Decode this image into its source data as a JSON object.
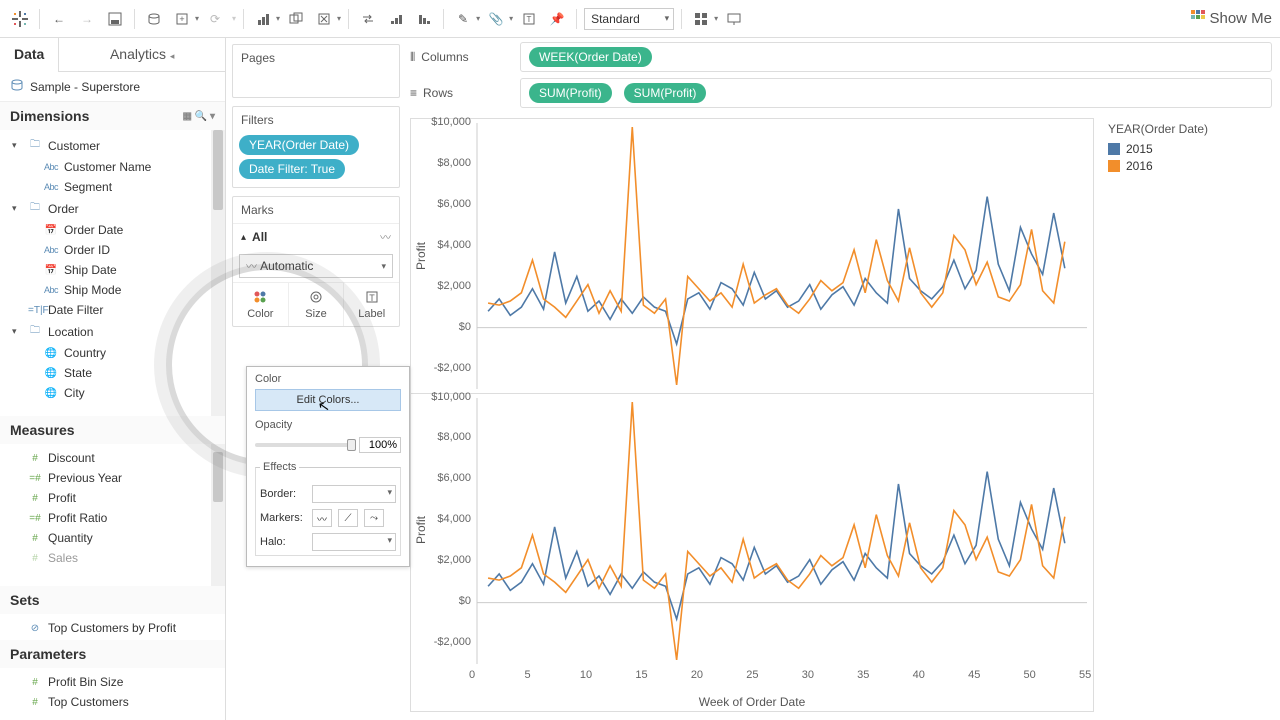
{
  "toolbar": {
    "fit_mode": "Standard",
    "show_me": "Show Me"
  },
  "data_pane": {
    "tab_data": "Data",
    "tab_analytics": "Analytics",
    "source": "Sample - Superstore",
    "sections": {
      "dimensions": "Dimensions",
      "measures": "Measures",
      "sets": "Sets",
      "parameters": "Parameters"
    },
    "dimensions": {
      "customer": {
        "label": "Customer",
        "children": [
          "Customer Name",
          "Segment"
        ]
      },
      "order": {
        "label": "Order",
        "children": [
          "Order Date",
          "Order ID",
          "Ship Date",
          "Ship Mode"
        ]
      },
      "date_filter": "Date Filter",
      "location": {
        "label": "Location",
        "children": [
          "Country",
          "State",
          "City"
        ]
      }
    },
    "measures": [
      "Discount",
      "Previous Year",
      "Profit",
      "Profit Ratio",
      "Quantity",
      "Sales"
    ],
    "sets": [
      "Top Customers by Profit"
    ],
    "parameters": [
      "Profit Bin Size",
      "Top Customers"
    ]
  },
  "cards": {
    "pages": "Pages",
    "filters": "Filters",
    "filter_pills": [
      "YEAR(Order Date)",
      "Date Filter: True"
    ],
    "marks": "Marks",
    "marks_all": "All",
    "marks_type": "Automatic",
    "marks_cells": {
      "color": "Color",
      "size": "Size",
      "label": "Label"
    }
  },
  "color_popup": {
    "title": "Color",
    "edit": "Edit Colors...",
    "opacity_label": "Opacity",
    "opacity_value": "100%",
    "effects": "Effects",
    "border": "Border:",
    "markers": "Markers:",
    "halo": "Halo:"
  },
  "shelves": {
    "columns": "Columns",
    "rows": "Rows",
    "col_pill": "WEEK(Order Date)",
    "row_pill1": "SUM(Profit)",
    "row_pill2": "SUM(Profit)"
  },
  "legend": {
    "title": "YEAR(Order Date)",
    "items": [
      {
        "label": "2015",
        "color": "#4e79a7"
      },
      {
        "label": "2016",
        "color": "#f28e2b"
      }
    ]
  },
  "chart_data": [
    {
      "type": "line",
      "title": "",
      "xlabel": "Week of Order Date",
      "ylabel": "Profit",
      "xlim": [
        0,
        55
      ],
      "ylim": [
        -3000,
        10000
      ],
      "y_ticks": [
        -2000,
        0,
        2000,
        4000,
        6000,
        8000,
        10000
      ],
      "y_tick_labels": [
        "-$2,000",
        "$0",
        "$2,000",
        "$4,000",
        "$6,000",
        "$8,000",
        "$10,000"
      ],
      "x_ticks": [
        0,
        5,
        10,
        15,
        20,
        25,
        30,
        35,
        40,
        45,
        50,
        55
      ],
      "series": [
        {
          "name": "2015",
          "color": "#4e79a7",
          "x": [
            1,
            2,
            3,
            4,
            5,
            6,
            7,
            8,
            9,
            10,
            11,
            12,
            13,
            14,
            15,
            16,
            17,
            18,
            19,
            20,
            21,
            22,
            23,
            24,
            25,
            26,
            27,
            28,
            29,
            30,
            31,
            32,
            33,
            34,
            35,
            36,
            37,
            38,
            39,
            40,
            41,
            42,
            43,
            44,
            45,
            46,
            47,
            48,
            49,
            50,
            51,
            52,
            53
          ],
          "values": [
            800,
            1400,
            600,
            1000,
            1900,
            900,
            3700,
            1200,
            2500,
            800,
            1300,
            400,
            1400,
            700,
            1500,
            1000,
            800,
            -800,
            1400,
            1700,
            900,
            2200,
            1900,
            1100,
            2700,
            1400,
            1800,
            1000,
            1300,
            2100,
            900,
            1600,
            2000,
            1100,
            2400,
            1700,
            1200,
            5800,
            2400,
            1800,
            1400,
            2000,
            3300,
            1900,
            2800,
            6400,
            3100,
            1800,
            4900,
            3600,
            2600,
            5600,
            2900
          ]
        },
        {
          "name": "2016",
          "color": "#f28e2b",
          "x": [
            1,
            2,
            3,
            4,
            5,
            6,
            7,
            8,
            9,
            10,
            11,
            12,
            13,
            14,
            15,
            16,
            17,
            18,
            19,
            20,
            21,
            22,
            23,
            24,
            25,
            26,
            27,
            28,
            29,
            30,
            31,
            32,
            33,
            34,
            35,
            36,
            37,
            38,
            39,
            40,
            41,
            42,
            43,
            44,
            45,
            46,
            47,
            48,
            49,
            50,
            51,
            52,
            53
          ],
          "values": [
            1200,
            1100,
            1300,
            1700,
            3300,
            1400,
            1000,
            500,
            1300,
            2100,
            700,
            1800,
            800,
            9800,
            1100,
            700,
            1400,
            -2800,
            2500,
            1900,
            1300,
            1700,
            1000,
            3100,
            1200,
            1600,
            1900,
            1100,
            700,
            1400,
            2300,
            1800,
            2200,
            3800,
            1700,
            4300,
            2300,
            1300,
            3900,
            1700,
            1000,
            1700,
            4500,
            3800,
            2100,
            3200,
            1500,
            1300,
            2100,
            4800,
            1800,
            1200,
            4200
          ]
        }
      ]
    },
    {
      "type": "line",
      "title": "",
      "xlabel": "Week of Order Date",
      "ylabel": "Profit",
      "xlim": [
        0,
        55
      ],
      "ylim": [
        -3000,
        10000
      ],
      "y_ticks": [
        -2000,
        0,
        2000,
        4000,
        6000,
        8000,
        10000
      ],
      "y_tick_labels": [
        "-$2,000",
        "$0",
        "$2,000",
        "$4,000",
        "$6,000",
        "$8,000",
        "$10,000"
      ],
      "x_ticks": [
        0,
        5,
        10,
        15,
        20,
        25,
        30,
        35,
        40,
        45,
        50,
        55
      ],
      "series": [
        {
          "name": "2015",
          "color": "#4e79a7",
          "x": [
            1,
            2,
            3,
            4,
            5,
            6,
            7,
            8,
            9,
            10,
            11,
            12,
            13,
            14,
            15,
            16,
            17,
            18,
            19,
            20,
            21,
            22,
            23,
            24,
            25,
            26,
            27,
            28,
            29,
            30,
            31,
            32,
            33,
            34,
            35,
            36,
            37,
            38,
            39,
            40,
            41,
            42,
            43,
            44,
            45,
            46,
            47,
            48,
            49,
            50,
            51,
            52,
            53
          ],
          "values": [
            800,
            1400,
            600,
            1000,
            1900,
            900,
            3700,
            1200,
            2500,
            800,
            1300,
            400,
            1400,
            700,
            1500,
            1000,
            800,
            -800,
            1400,
            1700,
            900,
            2200,
            1900,
            1100,
            2700,
            1400,
            1800,
            1000,
            1300,
            2100,
            900,
            1600,
            2000,
            1100,
            2400,
            1700,
            1200,
            5800,
            2400,
            1800,
            1400,
            2000,
            3300,
            1900,
            2800,
            6400,
            3100,
            1800,
            4900,
            3600,
            2600,
            5600,
            2900
          ]
        },
        {
          "name": "2016",
          "color": "#f28e2b",
          "x": [
            1,
            2,
            3,
            4,
            5,
            6,
            7,
            8,
            9,
            10,
            11,
            12,
            13,
            14,
            15,
            16,
            17,
            18,
            19,
            20,
            21,
            22,
            23,
            24,
            25,
            26,
            27,
            28,
            29,
            30,
            31,
            32,
            33,
            34,
            35,
            36,
            37,
            38,
            39,
            40,
            41,
            42,
            43,
            44,
            45,
            46,
            47,
            48,
            49,
            50,
            51,
            52,
            53
          ],
          "values": [
            1200,
            1100,
            1300,
            1700,
            3300,
            1400,
            1000,
            500,
            1300,
            2100,
            700,
            1800,
            800,
            9800,
            1100,
            700,
            1400,
            -2800,
            2500,
            1900,
            1300,
            1700,
            1000,
            3100,
            1200,
            1600,
            1900,
            1100,
            700,
            1400,
            2300,
            1800,
            2200,
            3800,
            1700,
            4300,
            2300,
            1300,
            3900,
            1700,
            1000,
            1700,
            4500,
            3800,
            2100,
            3200,
            1500,
            1300,
            2100,
            4800,
            1800,
            1200,
            4200
          ]
        }
      ]
    }
  ]
}
